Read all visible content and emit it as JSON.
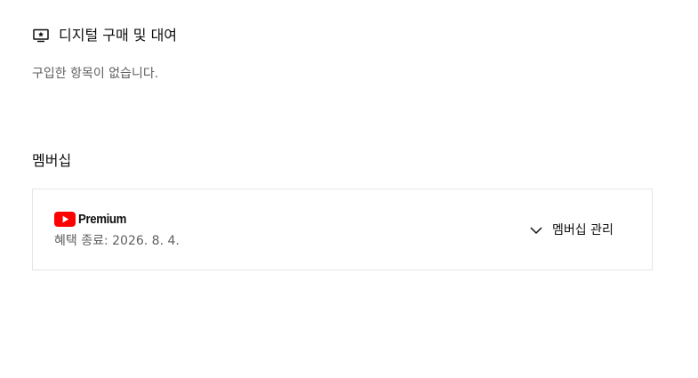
{
  "digital_purchases": {
    "icon": "tv-star-icon",
    "title": "디지털 구매 및 대여",
    "empty_message": "구입한 항목이 없습니다."
  },
  "membership": {
    "title": "멤버십",
    "card": {
      "logo_icon": "youtube-play-icon",
      "logo_text": "Premium",
      "benefit_end": "혜택 종료: 2026. 8. 4.",
      "manage_icon": "chevron-down-icon",
      "manage_label": "멤버십 관리"
    }
  },
  "colors": {
    "youtube_red": "#FF0000",
    "text_primary": "#0f0f0f",
    "text_secondary": "#606060",
    "card_border": "#e5e5e5"
  }
}
